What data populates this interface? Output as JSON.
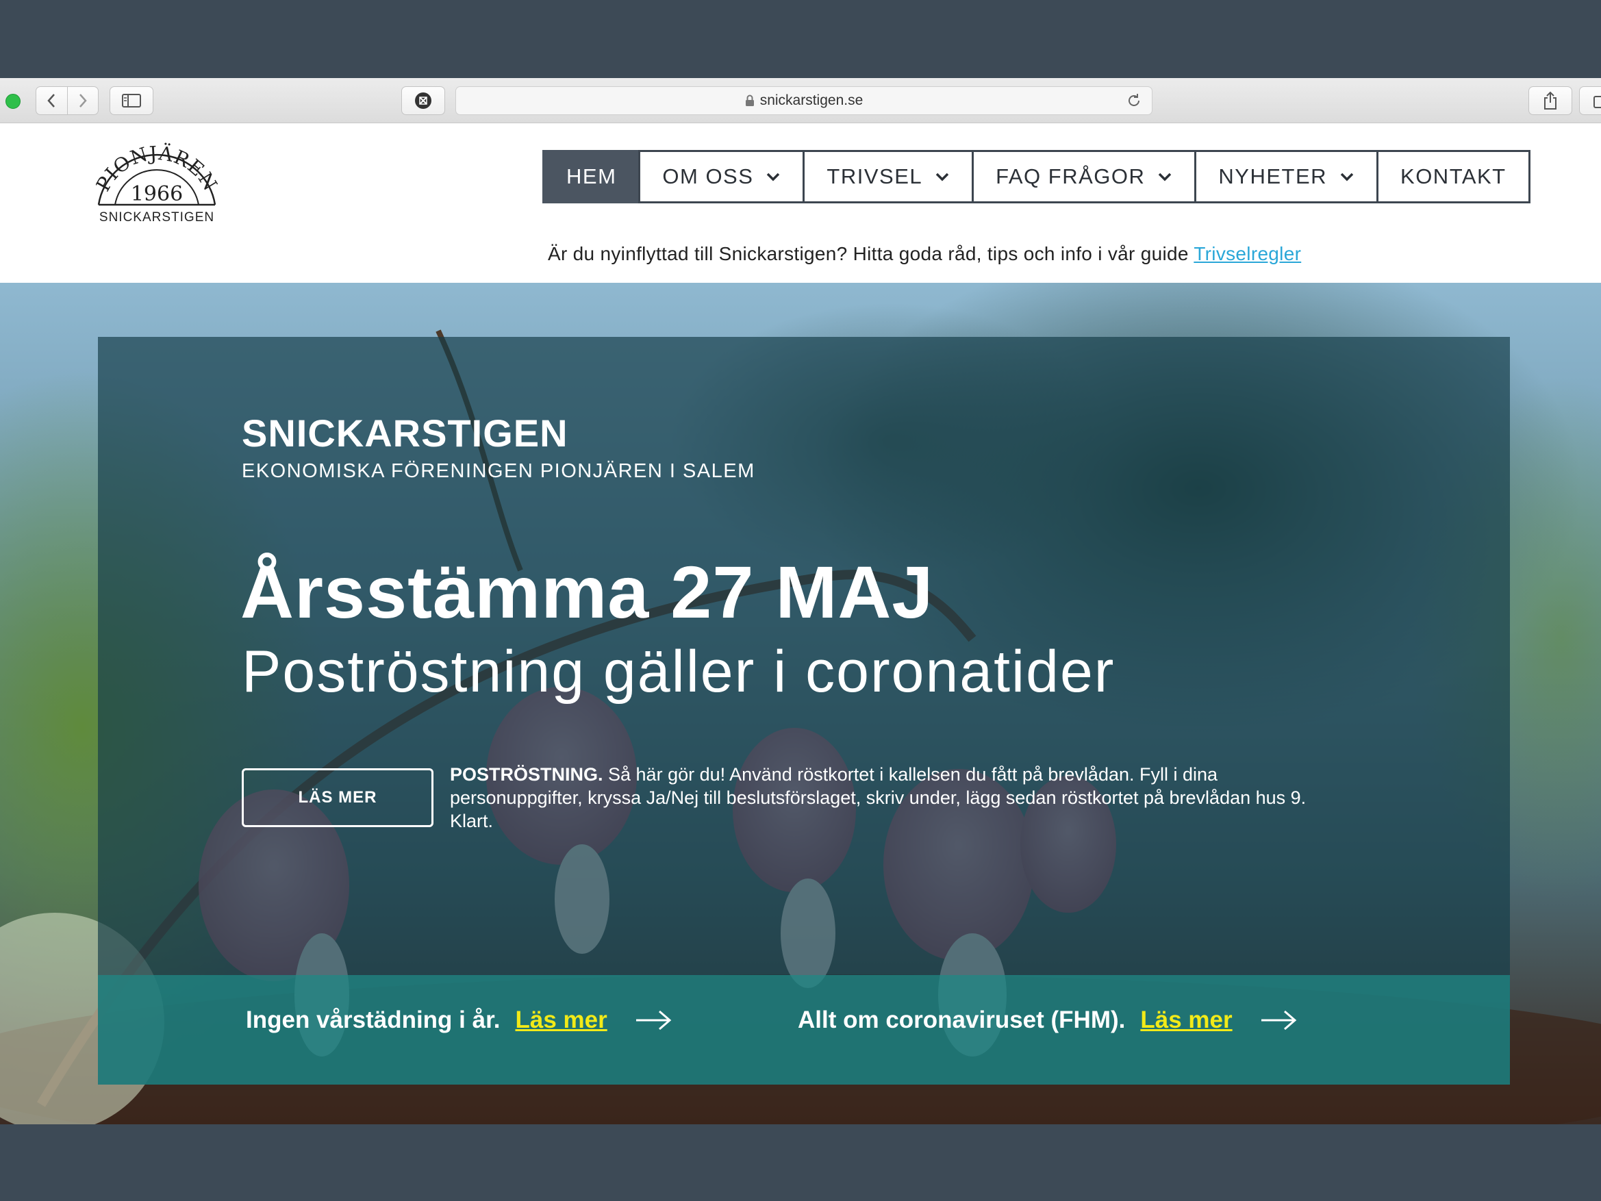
{
  "browser": {
    "url": "snickarstigen.se"
  },
  "site": {
    "logo_name": "PIONJÄREN",
    "logo_year": "1966",
    "logo_caption": "SNICKARSTIGEN"
  },
  "nav": {
    "items": [
      {
        "label": "HEM",
        "active": true,
        "dropdown": false
      },
      {
        "label": "OM OSS",
        "active": false,
        "dropdown": true
      },
      {
        "label": "TRIVSEL",
        "active": false,
        "dropdown": true
      },
      {
        "label": "FAQ FRÅGOR",
        "active": false,
        "dropdown": true
      },
      {
        "label": "NYHETER",
        "active": false,
        "dropdown": true
      },
      {
        "label": "KONTAKT",
        "active": false,
        "dropdown": false
      }
    ]
  },
  "notice": {
    "text": "Är du nyinflyttad till Snickarstigen? Hitta goda råd, tips och info i vår guide ",
    "link": "Trivselregler"
  },
  "hero": {
    "title": "SNICKARSTIGEN",
    "subtitle": "EKONOMISKA FÖRENINGEN PIONJÄREN I SALEM",
    "headline": "Årsstämma 27 MAJ",
    "subheadline": "Poströstning gäller i coronatider",
    "button": "LÄS MER",
    "body_bold": "POSTRÖSTNING.",
    "body": " Så här gör du! Använd röstkortet i kallelsen du fått på brevlådan. Fyll i dina personuppgifter, kryssa Ja/Nej till beslutsförslaget, skriv under, lägg sedan röstkortet på brevlådan hus 9. Klart."
  },
  "bar": {
    "items": [
      {
        "text": "Ingen vårstädning i år.",
        "link": "Läs mer"
      },
      {
        "text": "Allt om coronaviruset (FHM).",
        "link": "Läs mer"
      }
    ]
  },
  "colors": {
    "nav_active": "#4b5561",
    "link_notice": "#2aa7d8",
    "link_bar": "#f2ea18",
    "panel": "#143c48",
    "bar": "#1d7a7a"
  }
}
